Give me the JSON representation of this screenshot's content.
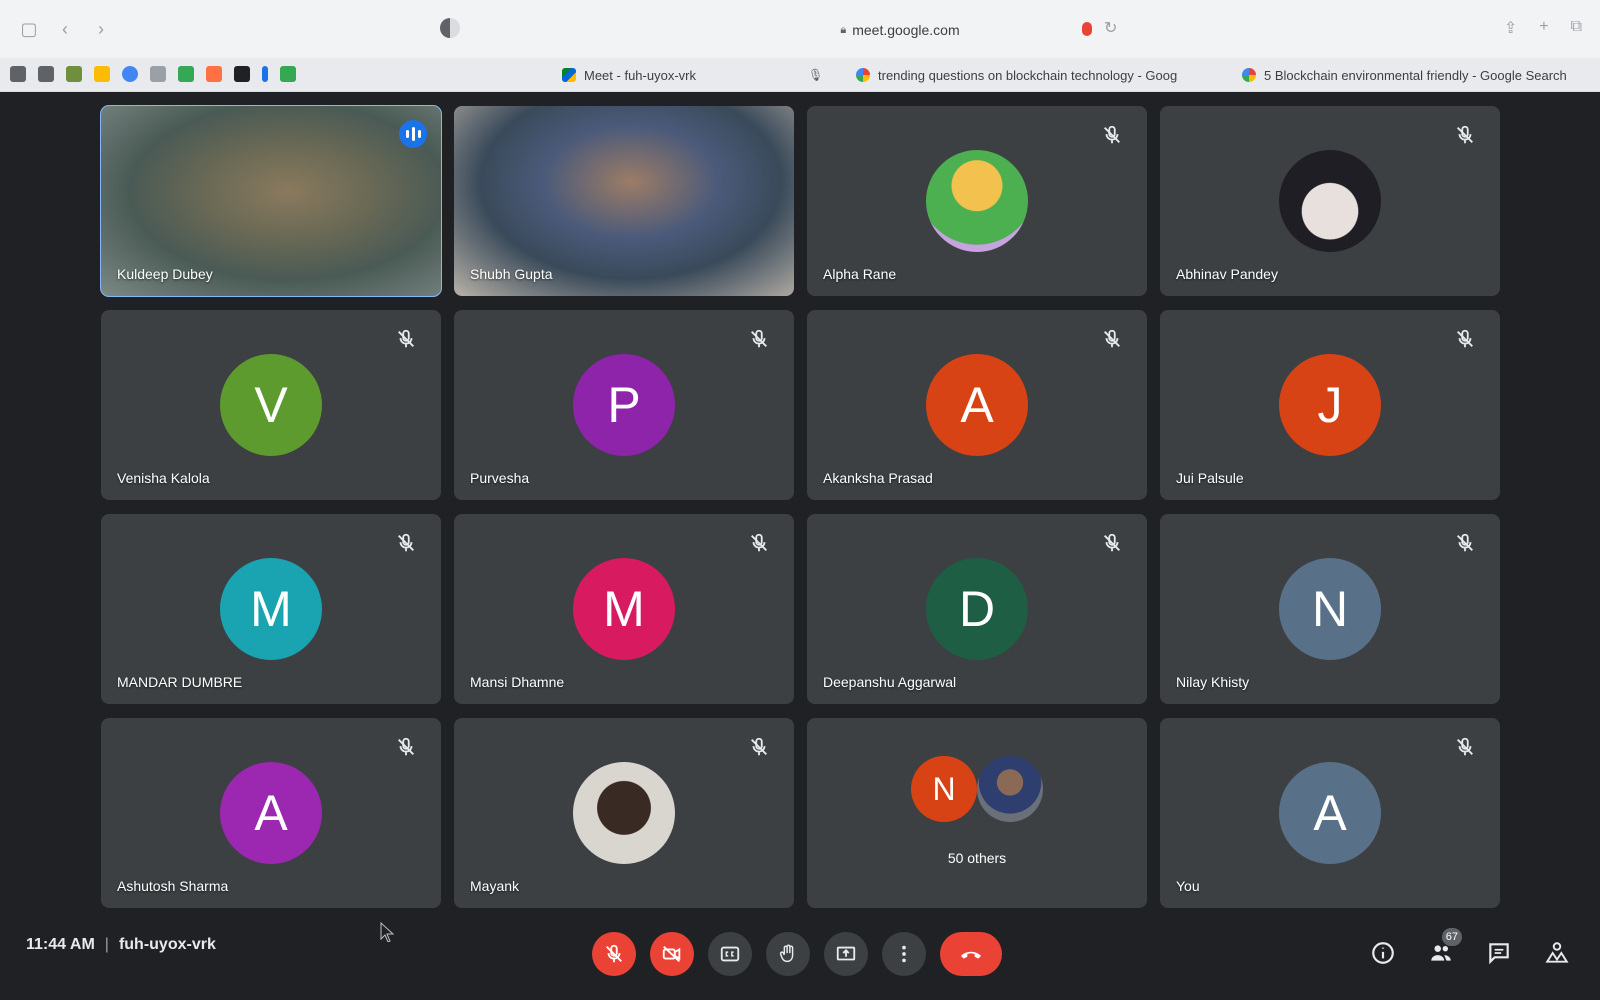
{
  "browser": {
    "url": "meet.google.com",
    "tabs": [
      {
        "label": "Meet - fuh-uyox-vrk",
        "favicon": "google-meet-icon"
      },
      {
        "label": "trending questions on blockchain technology - Goog",
        "favicon": "google-icon"
      },
      {
        "label": "5 Blockchain environmental friendly - Google Search",
        "favicon": "google-icon"
      }
    ]
  },
  "tiles": [
    {
      "name": "Kuldeep Dubey",
      "kind": "video",
      "speaking": true,
      "muted": false
    },
    {
      "name": "Shubh Gupta",
      "kind": "video",
      "speaking": false,
      "muted": false
    },
    {
      "name": "Alpha Rane",
      "kind": "photo",
      "muted": true
    },
    {
      "name": "Abhinav Pandey",
      "kind": "photo",
      "muted": true
    },
    {
      "name": "Venisha Kalola",
      "kind": "initial",
      "initial": "V",
      "color": "#5e9b2f",
      "muted": true
    },
    {
      "name": "Purvesha",
      "kind": "initial",
      "initial": "P",
      "color": "#8e24aa",
      "muted": true
    },
    {
      "name": "Akanksha Prasad",
      "kind": "initial",
      "initial": "A",
      "color": "#d84315",
      "muted": true
    },
    {
      "name": "Jui Palsule",
      "kind": "initial",
      "initial": "J",
      "color": "#d84315",
      "muted": true
    },
    {
      "name": "MANDAR DUMBRE",
      "kind": "initial",
      "initial": "M",
      "color": "#1aa3b0",
      "muted": true
    },
    {
      "name": "Mansi Dhamne",
      "kind": "initial",
      "initial": "M",
      "color": "#d81b60",
      "muted": true
    },
    {
      "name": "Deepanshu Aggarwal",
      "kind": "initial",
      "initial": "D",
      "color": "#1e5e45",
      "muted": true
    },
    {
      "name": "Nilay Khisty",
      "kind": "initial",
      "initial": "N",
      "color": "#587189",
      "muted": true
    },
    {
      "name": "Ashutosh Sharma",
      "kind": "initial",
      "initial": "A",
      "color": "#9c27b0",
      "muted": true
    },
    {
      "name": "Mayank",
      "kind": "photo",
      "muted": true
    },
    {
      "name": "",
      "kind": "others",
      "others_label": "50 others",
      "initial": "N",
      "color": "#d84315"
    },
    {
      "name": "You",
      "kind": "initial",
      "initial": "A",
      "color": "#587189",
      "muted": true
    }
  ],
  "bottom": {
    "time": "11:44 AM",
    "separator": "|",
    "meeting_code": "fuh-uyox-vrk",
    "participants_count": "67",
    "controls": [
      "mic-off",
      "camera-off",
      "captions",
      "raise-hand",
      "present",
      "more-options",
      "leave-call"
    ]
  },
  "colors": {
    "background": "#202124",
    "tile": "#3c4043",
    "accent": "#8ab4f8",
    "danger": "#ea4335"
  }
}
